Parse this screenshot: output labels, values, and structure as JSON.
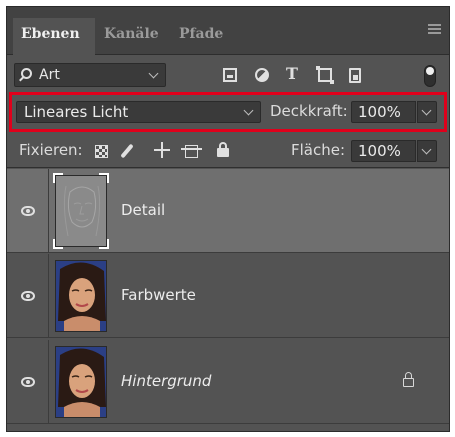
{
  "tabs": [
    {
      "label": "Ebenen",
      "active": true
    },
    {
      "label": "Kanäle",
      "active": false
    },
    {
      "label": "Pfade",
      "active": false
    }
  ],
  "filter": {
    "kind_label": "Art",
    "icons": [
      "pixel-layer-filter-icon",
      "adjustment-layer-filter-icon",
      "type-layer-filter-icon",
      "shape-layer-filter-icon",
      "smart-object-filter-icon"
    ]
  },
  "blend": {
    "mode": "Lineares Licht",
    "opacity_label": "Deckkraft:",
    "opacity_value": "100%"
  },
  "locks": {
    "label": "Fixieren:",
    "fill_label": "Fläche:",
    "fill_value": "100%"
  },
  "layers": [
    {
      "name": "Detail",
      "visible": true,
      "selected": true,
      "locked": false,
      "italic": false
    },
    {
      "name": "Farbwerte",
      "visible": true,
      "selected": false,
      "locked": false,
      "italic": false
    },
    {
      "name": "Hintergrund",
      "visible": true,
      "selected": false,
      "locked": true,
      "italic": true
    }
  ],
  "colors": {
    "panel_bg": "#535353",
    "tabbar_bg": "#424242",
    "selected_layer": "#6f6f6f",
    "highlight": "#e0001b"
  }
}
